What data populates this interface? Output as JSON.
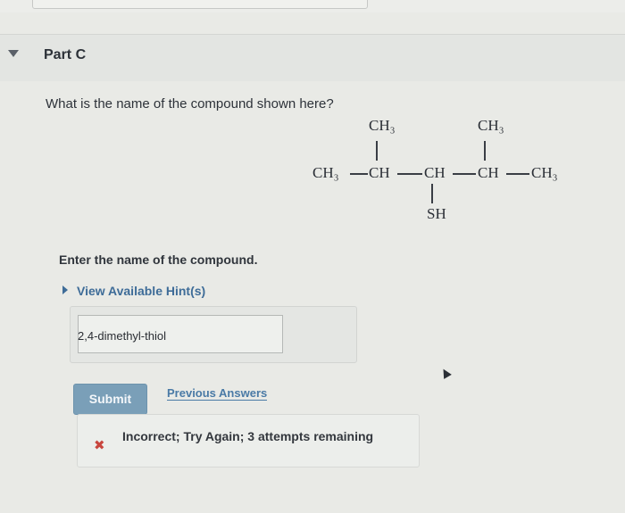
{
  "part": {
    "title": "Part C"
  },
  "question": {
    "text": "What is the name of the compound shown here?"
  },
  "structure": {
    "top_left": "CH₃",
    "top_right": "CH₃",
    "chain": [
      "CH₃",
      "CH",
      "CH",
      "CH",
      "CH₃"
    ],
    "bottom": "SH"
  },
  "prompt": {
    "text": "Enter the name of the compound."
  },
  "hint": {
    "label": "View Available Hint(s)"
  },
  "answer": {
    "value": "2,4-dimethyl-thiol"
  },
  "submit": {
    "label": "Submit"
  },
  "previous": {
    "label": "Previous Answers"
  },
  "feedback": {
    "text": "Incorrect; Try Again; 3 attempts remaining",
    "icon": "x-icon"
  },
  "colors": {
    "accent": "#7a9fb8",
    "link": "#4a7aa6",
    "error": "#c8463e"
  }
}
